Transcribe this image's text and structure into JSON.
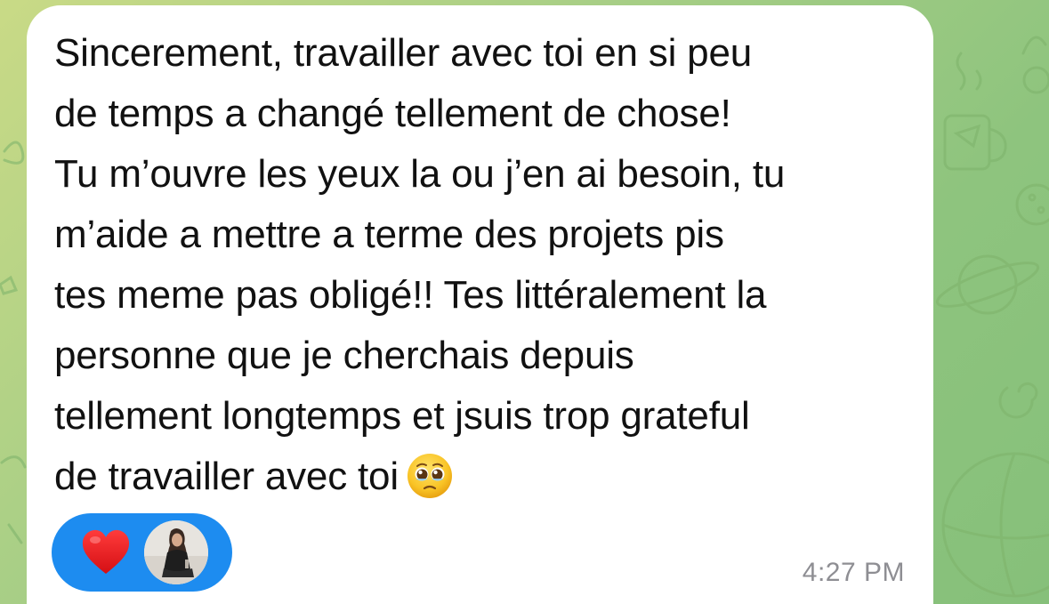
{
  "message": {
    "lines": [
      "Sincerement, travailler avec toi en si peu",
      "de temps a changé tellement de chose!",
      "Tu m’ouvre les yeux la ou j’en ai besoin, tu",
      "m’aide a mettre a terme des projets pis",
      "tes meme pas obligé!! Tes littéralement la",
      "personne que je cherchais depuis",
      "tellement longtemps et jsuis trop grateful",
      "de travailler avec toi"
    ],
    "emoji": "pleading-face-with-tears-icon",
    "timestamp": "4:27 PM"
  },
  "reaction": {
    "icon": "heart-icon",
    "reactor_avatar": "avatar"
  },
  "colors": {
    "bubble": "#ffffff",
    "reaction_pill": "#1d8cf0",
    "heart": "#e3171b",
    "timestamp": "#8e8e93"
  }
}
